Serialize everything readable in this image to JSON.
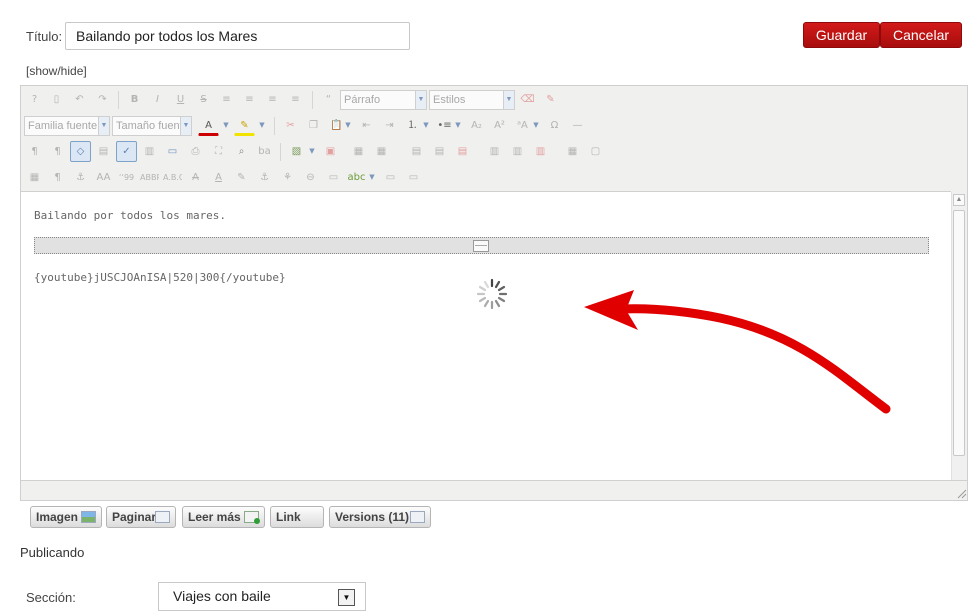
{
  "form": {
    "title_label": "Título:",
    "title_value": "Bailando por todos los Mares",
    "save_label": "Guardar",
    "cancel_label": "Cancelar",
    "show_hide_label": "[show/hide]"
  },
  "toolbar": {
    "format_select": "Párrafo",
    "styles_select": "Estilos",
    "font_family_select": "Familia fuente",
    "font_size_select": "Tamaño fuente"
  },
  "editor": {
    "content_text": "Bailando por todos los mares.",
    "youtube_code": "{youtube}jUSCJOAnISA|520|300{/youtube}"
  },
  "buttons": {
    "image_label": "Imagen",
    "paginate_label": "Paginar",
    "readmore_label": "Leer más",
    "link_label": "Link",
    "versions_label": "Versions (11)"
  },
  "publishing": {
    "heading": "Publicando",
    "section_label": "Sección:",
    "section_value": "Viajes con baile"
  },
  "colors": {
    "primary_button": "#c0141a",
    "annotation_arrow": "#e00000"
  }
}
